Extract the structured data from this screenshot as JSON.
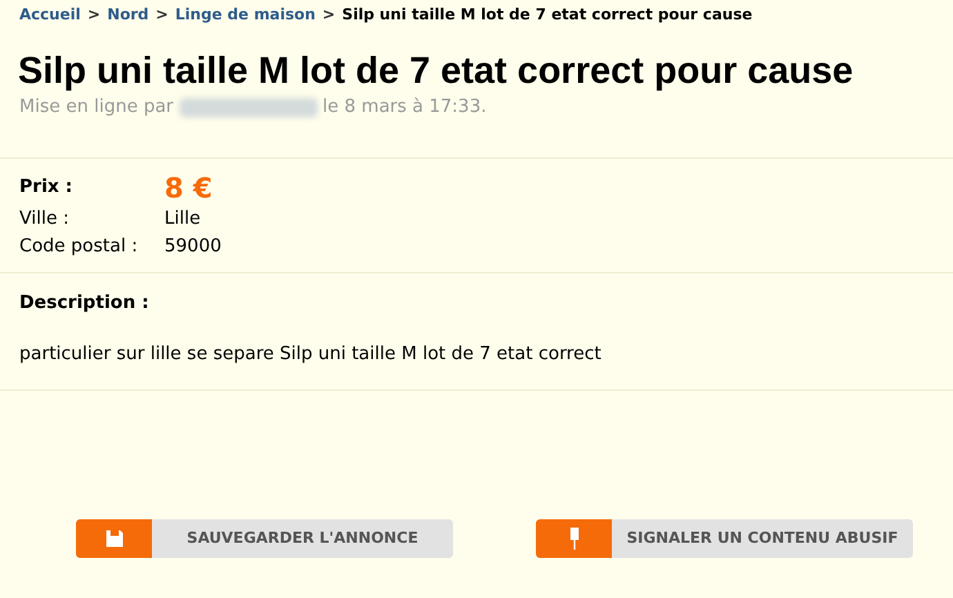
{
  "breadcrumb": [
    {
      "label": "Accueil",
      "kind": "link"
    },
    {
      "label": "Nord",
      "kind": "link"
    },
    {
      "label": "Linge de maison",
      "kind": "link"
    },
    {
      "label": "Silp uni taille M lot de 7 etat correct pour cause",
      "kind": "current"
    }
  ],
  "separator": ">",
  "title": "Silp uni taille M lot de 7 etat correct pour cause",
  "posted": {
    "prefix": "Mise en ligne par",
    "suffix": "le 8 mars à 17:33."
  },
  "details": [
    {
      "label": "Prix :",
      "value": "8 €",
      "kind": "price"
    },
    {
      "label": "Ville :",
      "value": "Lille",
      "kind": "plain"
    },
    {
      "label": "Code postal :",
      "value": "59000",
      "kind": "plain"
    }
  ],
  "description": {
    "heading": "Description :",
    "text": "particulier sur lille se separe Silp uni taille M lot de 7 etat correct"
  },
  "actions": [
    {
      "label": "SAUVEGARDER L'ANNONCE",
      "kind": "save"
    },
    {
      "label": "SIGNALER UN CONTENU ABUSIF",
      "kind": "report"
    }
  ]
}
